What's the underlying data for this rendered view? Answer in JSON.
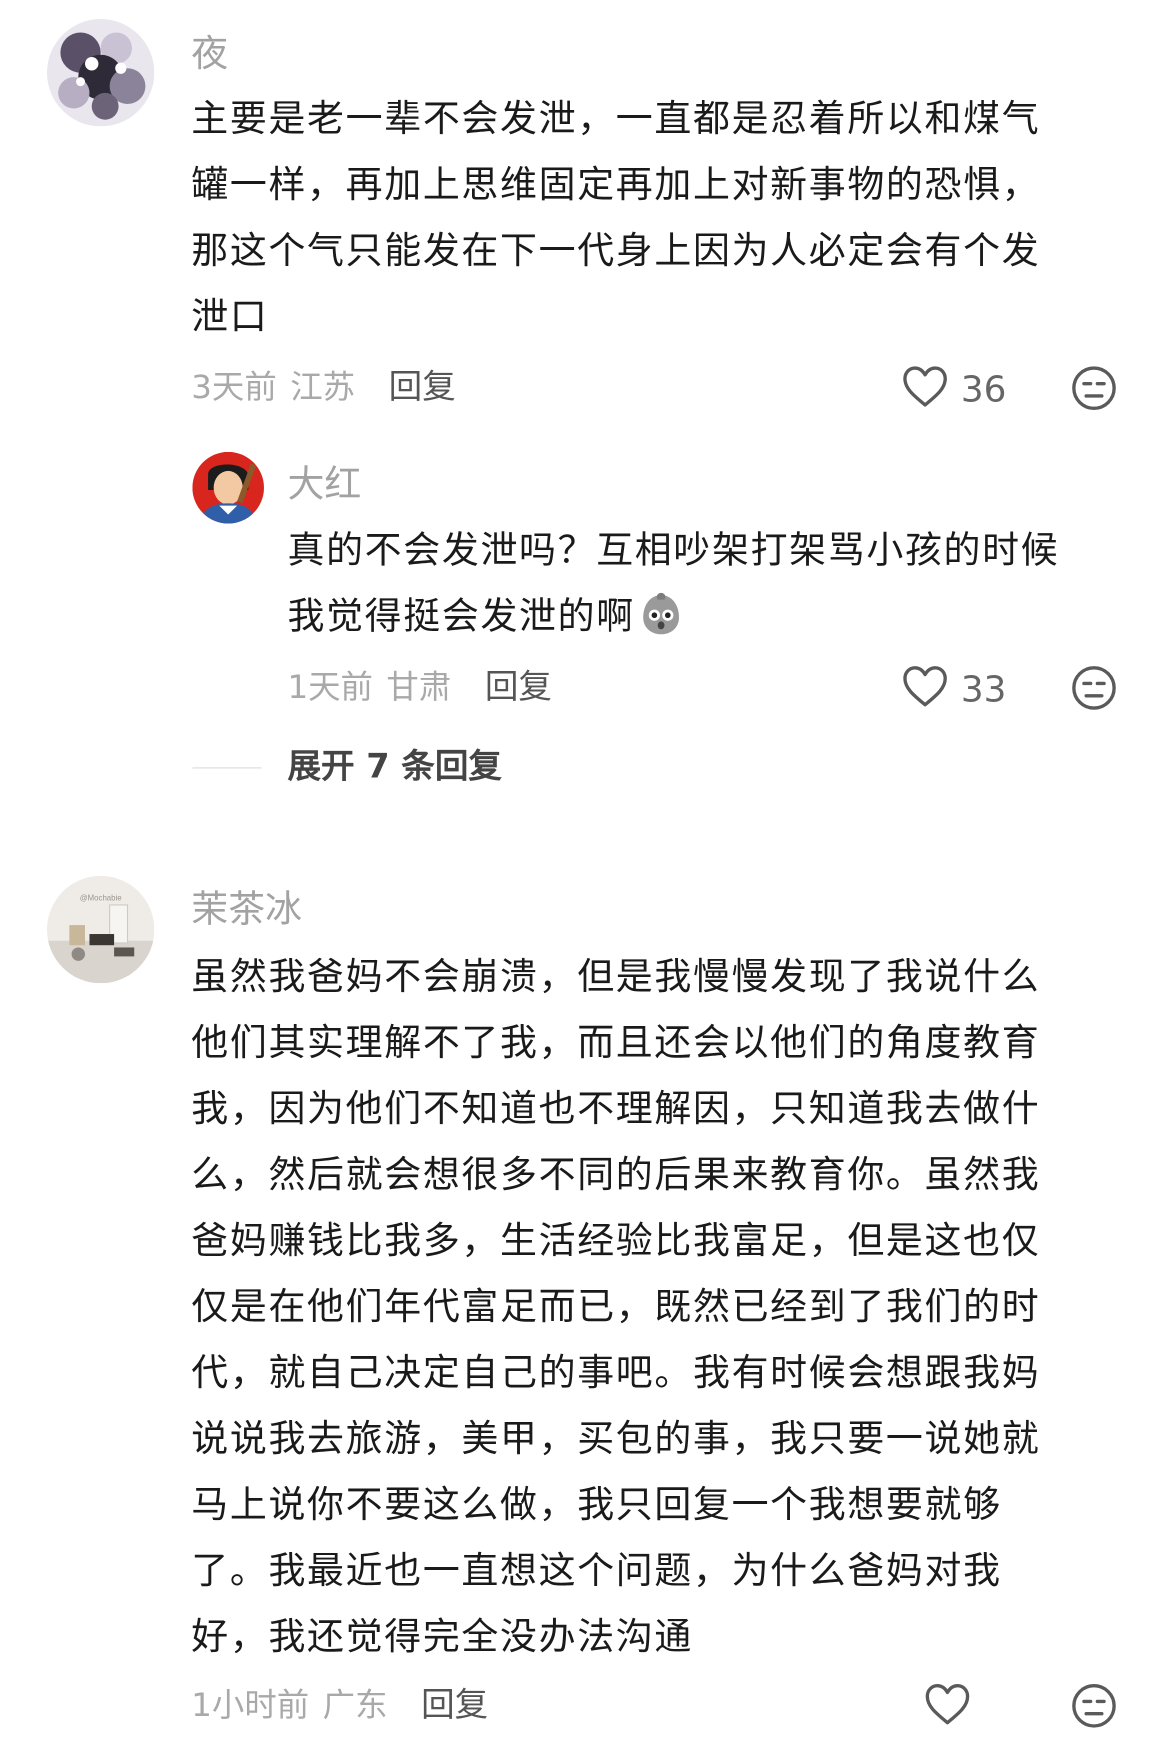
{
  "comments": [
    {
      "username": "夜",
      "lines": [
        "主要是老一辈不会发泄，一直都是忍着所以和煤气",
        "罐一样，再加上思维固定再加上对新事物的恐惧，",
        "那这个气只能发在下一代身上因为人必定会有个发",
        "泄口"
      ],
      "time": "3天前",
      "location": "江苏",
      "reply_label": "回复",
      "likes": "36",
      "reply": {
        "username": "大红",
        "lines": [
          "真的不会发泄吗？互相吵架打架骂小孩的时候",
          "我觉得挺会发泄的啊"
        ],
        "emoji": "shocked-face-emoji",
        "time": "1天前",
        "location": "甘肃",
        "reply_label": "回复",
        "likes": "33"
      },
      "expand_label": "展开 7 条回复"
    },
    {
      "username": "茉茶冰",
      "avatar_caption": "@Mochabie",
      "lines": [
        "虽然我爸妈不会崩溃，但是我慢慢发现了我说什么",
        "他们其实理解不了我，而且还会以他们的角度教育",
        "我，因为他们不知道也不理解因，只知道我去做什",
        "么，然后就会想很多不同的后果来教育你。虽然我",
        "爸妈赚钱比我多，生活经验比我富足，但是这也仅",
        "仅是在他们年代富足而已，既然已经到了我们的时",
        "代，就自己决定自己的事吧。我有时候会想跟我妈",
        "说说我去旅游，美甲，买包的事，我只要一说她就",
        "马上说你不要这么做，我只回复一个我想要就够",
        "了。我最近也一直想这个问题，为什么爸妈对我",
        "好，我还觉得完全没办法沟通"
      ],
      "time": "1小时前",
      "location": "广东",
      "reply_label": "回复"
    }
  ],
  "icons": {
    "like": "heart-outline-icon",
    "dislike": "unamused-face-icon"
  },
  "colors": {
    "text": "#1a1a1a",
    "meta": "#a9a9a9",
    "username": "#a2a2a2"
  }
}
